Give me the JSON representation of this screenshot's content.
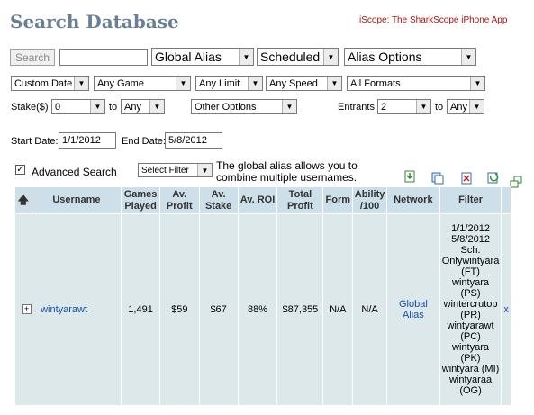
{
  "header": {
    "title": "Search Database",
    "promo_link": "iScope: The SharkScope iPhone App"
  },
  "search": {
    "button": "Search",
    "query": "",
    "alias_scope": "Global Alias",
    "schedule": "Scheduled",
    "alias_options": "Alias Options"
  },
  "filters_row1": {
    "date_range": "Custom Date",
    "game": "Any Game",
    "limit": "Any Limit",
    "speed": "Any Speed",
    "format": "All Formats"
  },
  "filters_row2": {
    "stake_label": "Stake($)",
    "stake_from": "0",
    "to_label": "to",
    "stake_to": "Any",
    "other_options": "Other Options",
    "entrants_label": "Entrants",
    "entrants_from": "2",
    "entrants_to": "Any"
  },
  "dates": {
    "start_label": "Start Date:",
    "start_value": "1/1/2012",
    "end_label": "End Date:",
    "end_value": "5/8/2012"
  },
  "advanced": {
    "checkbox_label": "Advanced Search",
    "checked": true,
    "select_filter": "Select Filter",
    "tip_line1": "The global alias allows you to",
    "tip_line2": "combine multiple usernames."
  },
  "table": {
    "columns": [
      "Username",
      "Games Played",
      "Av. Profit",
      "Av. Stake",
      "Av. ROI",
      "Total Profit",
      "Form",
      "Ability /100",
      "Network",
      "Filter"
    ],
    "row": {
      "expand": "+",
      "username": "wintyarawt",
      "games_played": "1,491",
      "av_profit": "$59",
      "av_stake": "$67",
      "av_roi": "88%",
      "total_profit": "$87,355",
      "form": "N/A",
      "ability": "N/A",
      "network": "Global Alias",
      "filter_lines": [
        "1/1/2012",
        "5/8/2012",
        "Sch.",
        "Onlywintyara",
        "(FT)",
        "wintyara",
        "(PS)",
        "wintercrutop",
        "(PR)",
        "wintyarawt",
        "(PC)",
        "wintyara",
        "(PK)",
        "wintyara (MI)",
        "wintyaraa",
        "(OG)"
      ],
      "remove": "x"
    }
  }
}
